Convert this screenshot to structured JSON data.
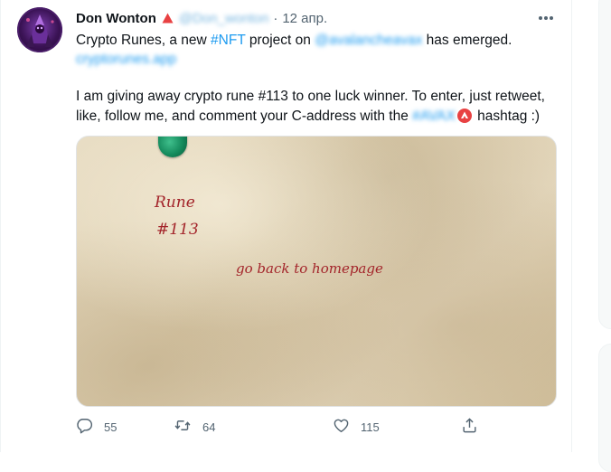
{
  "tweet": {
    "display_name": "Don Wonton",
    "handle": "@Don_wonton",
    "separator": "·",
    "timestamp": "12 апр.",
    "text": {
      "line1_a": "Crypto Runes, a new ",
      "line1_hashtag": "#NFT",
      "line1_b": " project on ",
      "line1_mention": "@avalancheavax",
      "line1_c": " has emerged.",
      "link": "cryptorunes.app",
      "line3": "I am giving away crypto rune #113 to one luck winner. To enter, just retweet,",
      "line4_a": "like, follow me, and comment your C-address with the ",
      "line4_hashtag": "#AVAX",
      "line4_b": " hashtag :)"
    }
  },
  "media": {
    "rune_title": "Rune",
    "rune_number": "#113",
    "homepage_link": "go back to homepage"
  },
  "actions": {
    "reply_count": "55",
    "retweet_count": "64",
    "like_count": "115"
  },
  "icons": {
    "verified": "avax-triangle-icon",
    "more": "more-horizontal-icon",
    "reply": "reply-icon",
    "retweet": "retweet-icon",
    "like": "heart-icon",
    "share": "share-icon"
  },
  "colors": {
    "accent": "#1d9bf0",
    "avax_red": "#e84142",
    "rune_text": "#a3242a",
    "muted": "#536471"
  }
}
